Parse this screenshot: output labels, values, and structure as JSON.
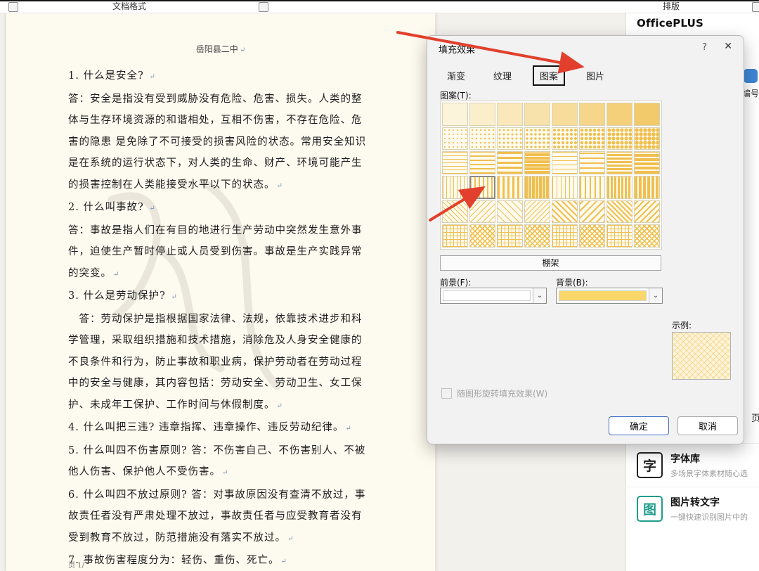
{
  "top_bar": {
    "left_label": "文档格式",
    "right_label": "排版"
  },
  "document": {
    "header": "岳阳县二中",
    "paragraph_mark": "↵",
    "paragraphs": [
      "1. 什么是安全? ",
      "答：安全是指没有受到威胁没有危险、危害、损失。人类的整体与生存环境资源的和谐相处，互相不伤害，不存在危险、危害的隐患 是免除了不可接受的损害风险的状态。常用安全知识是在系统的运行状态下，对人类的生命、财产、环境可能产生的损害控制在人类能接受水平以下的状态。",
      "2. 什么叫事故? ",
      "答：事故是指人们在有目的地进行生产劳动中突然发生意外事件，迫使生产暂时停止或人员受到伤害。事故是生产实践异常的突变。",
      "3. 什么是劳动保护? ",
      "　答：劳动保护是指根据国家法律、法规，依靠技术进步和科学管理，采取组织措施和技术措施，消除危及人身安全健康的不良条件和行为，防止事故和职业病，保护劳动者在劳动过程中的安全与健康，其内容包括：劳动安全、劳动卫生、女工保护、未成年工保护、工作时间与休假制度。",
      "4. 什么叫把三违? 违章指挥、违章操作、违反劳动纪律。",
      "5. 什么叫四不伤害原则? 答：不伤害自己、不伤害别人、不被他人伤害、保护他人不受伤害。",
      "6. 什么叫四不放过原则? 答：对事故原因没有查清不放过，事故责任者没有严肃处理不放过，事故责任者与应受教育者没有受到教育不放过，防范措施没有落实不放过。",
      "7. 事故伤害程度分为：轻伤、重伤、死亡。"
    ],
    "page_footer": "页 1/"
  },
  "dialog": {
    "title": "填充效果",
    "help_label": "?",
    "close_label": "✕",
    "tabs": [
      "渐变",
      "纹理",
      "图案",
      "图片"
    ],
    "active_tab_index": 2,
    "pattern_label": "图案(T):",
    "pattern_grid": {
      "rows": 6,
      "cols": 8,
      "selected_index": 25,
      "foreground": "#f0bf4e",
      "background": "#fefbee"
    },
    "pattern_name": "棚架",
    "foreground_label": "前景(F):",
    "foreground_value": "#ffffff",
    "background_label": "背景(B):",
    "background_value": "#f9d76a",
    "example_label": "示例:",
    "example_fill": "#fcf4d9",
    "checkbox_label": "随图形旋转填充效果(W)",
    "ok_label": "确定",
    "cancel_label": "取消"
  },
  "sidebar": {
    "brand": "OfficePLUS",
    "partial_top_label": "编号",
    "partial_mid_label": "页",
    "items": [
      {
        "title": "字体库",
        "subtitle": "多场景字体素材随心选",
        "icon": "font-library-icon",
        "icon_char": "字",
        "icon_color": "#222222"
      },
      {
        "title": "图片转文字",
        "subtitle": "一键快速识别图片中的",
        "icon": "image-to-text-icon",
        "icon_char": "图",
        "icon_color": "#1f9d8b"
      }
    ]
  }
}
